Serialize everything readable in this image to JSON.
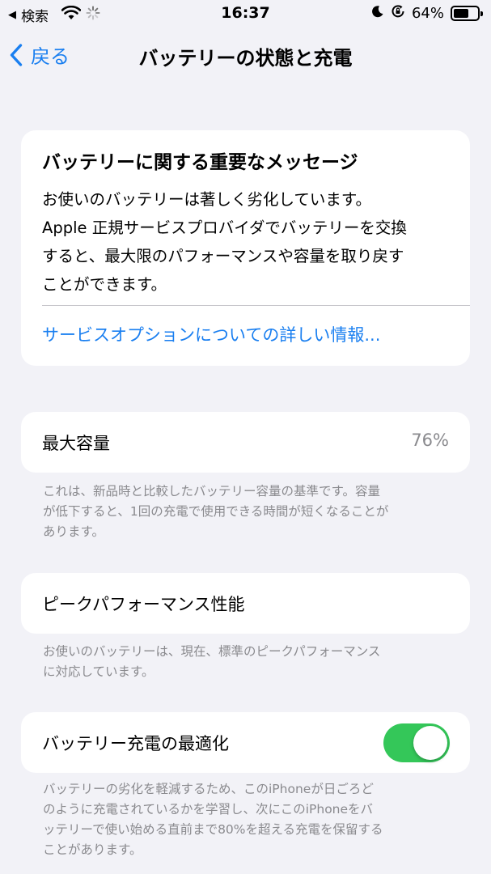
{
  "status_bar": {
    "back_app": "検索",
    "time": "16:37",
    "battery_percent": "64%",
    "battery_level": 0.64,
    "icons": [
      "back-triangle-icon",
      "wifi-icon",
      "loading-spinner-icon",
      "moon-icon",
      "orientation-lock-icon",
      "battery-icon"
    ]
  },
  "nav": {
    "back_label": "戻る",
    "title": "バッテリーの状態と充電"
  },
  "message_card": {
    "title": "バッテリーに関する重要なメッセージ",
    "lines": [
      "お使いのバッテリーは著しく劣化しています。",
      "Apple 正規サービスプロバイダでバッテリーを交換",
      "すると、最大限のパフォーマンスや容量を取り戻す",
      "ことができます。"
    ],
    "link": "サービスオプションについての詳しい情報..."
  },
  "max_capacity": {
    "label": "最大容量",
    "value": "76%",
    "note_lines": [
      "これは、新品時と比較したバッテリー容量の基準です。容量",
      "が低下すると、1回の充電で使用できる時間が短くなることが",
      "あります。"
    ]
  },
  "peak_performance": {
    "label": "ピークパフォーマンス性能",
    "note_lines": [
      "お使いのバッテリーは、現在、標準のピークパフォーマンス",
      "に対応しています。"
    ]
  },
  "optimized_charging": {
    "label": "バッテリー充電の最適化",
    "enabled": true,
    "toggle_color": "#34c759",
    "note_lines": [
      "バッテリーの劣化を軽減するため、このiPhoneが日ごろど",
      "のように充電されているかを学習し、次にこのiPhoneをバ",
      "ッテリーで使い始める直前まで80%を超える充電を保留する",
      "ことがあります。"
    ]
  },
  "colors": {
    "accent": "#1a7ff0",
    "background": "#f2f2f7",
    "secondary_text": "#8a8a8e"
  }
}
